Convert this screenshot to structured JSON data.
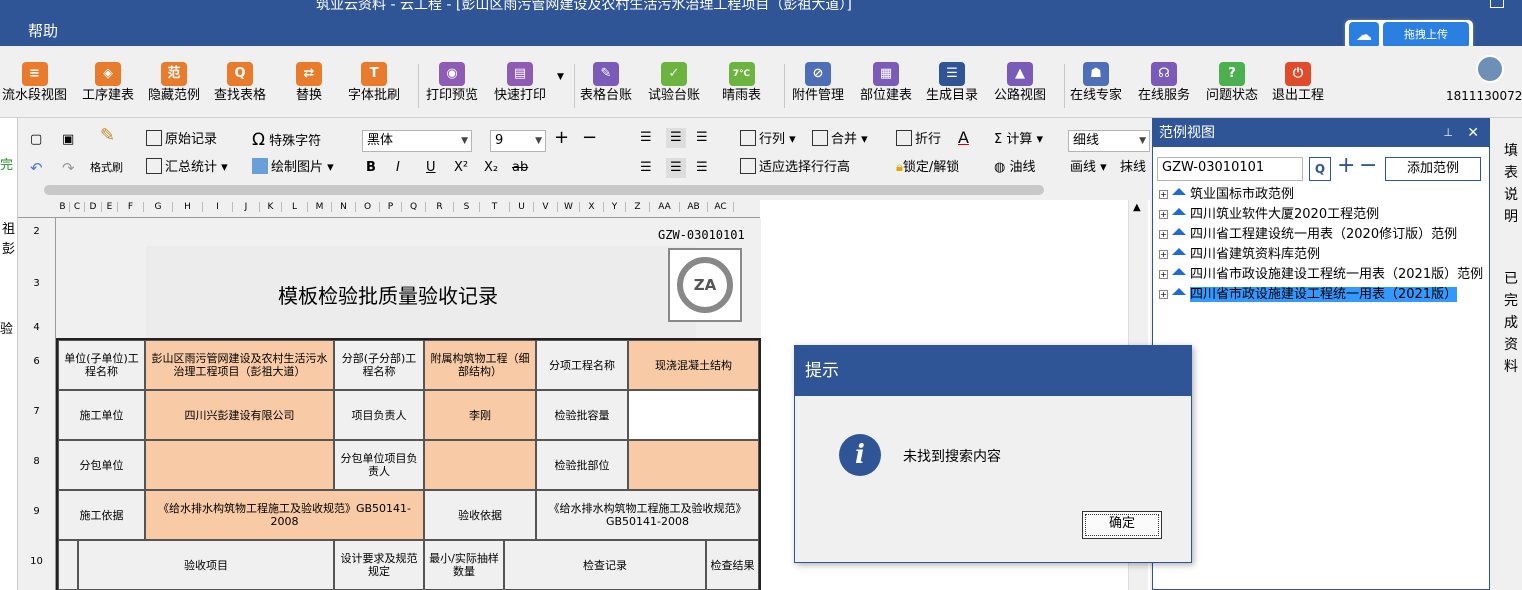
{
  "window": {
    "title": "筑业云资料 - 云工程 - [彭山区雨污管网建设及农村生活污水治理工程项目（彭祖大道）]"
  },
  "menu": {
    "help": "帮助"
  },
  "upload": {
    "label": "拖拽上传"
  },
  "user": {
    "phone": "1811130072"
  },
  "ribbon": {
    "items": [
      {
        "label": "流水段视图",
        "icon": "flow-icon",
        "color": "#e87b2c",
        "glyph": "≡"
      },
      {
        "label": "工序建表",
        "icon": "layers-icon",
        "color": "#e87b2c",
        "glyph": "◈"
      },
      {
        "label": "隐藏范例",
        "icon": "example-icon",
        "color": "#e87b2c",
        "glyph": "范"
      },
      {
        "label": "查找表格",
        "icon": "search-icon",
        "color": "#e87b2c",
        "glyph": "Q"
      },
      {
        "label": "替换",
        "icon": "replace-icon",
        "color": "#e87b2c",
        "glyph": "⇄"
      },
      {
        "label": "字体批刷",
        "icon": "font-brush-icon",
        "color": "#e87b2c",
        "glyph": "T"
      },
      {
        "label": "打印预览",
        "icon": "eye-icon",
        "color": "#8e5bb5",
        "glyph": "◉"
      },
      {
        "label": "快速打印",
        "icon": "printer-icon",
        "color": "#8e5bb5",
        "glyph": "▤"
      },
      {
        "label": "表格台账",
        "icon": "ledger-icon",
        "color": "#7a5cb8",
        "glyph": "✎"
      },
      {
        "label": "试验台账",
        "icon": "test-icon",
        "color": "#6cb33f",
        "glyph": "✓"
      },
      {
        "label": "晴雨表",
        "icon": "weather-icon",
        "color": "#6cb33f",
        "glyph": "7℃"
      },
      {
        "label": "附件管理",
        "icon": "attachment-icon",
        "color": "#4e6fb8",
        "glyph": "⊘"
      },
      {
        "label": "部位建表",
        "icon": "grid-icon",
        "color": "#7a5cb8",
        "glyph": "▦"
      },
      {
        "label": "生成目录",
        "icon": "catalog-icon",
        "color": "#2f5597",
        "glyph": "☰"
      },
      {
        "label": "公路视图",
        "icon": "road-icon",
        "color": "#7a5cb8",
        "glyph": "▲"
      },
      {
        "label": "在线专家",
        "icon": "expert-icon",
        "color": "#4e6fb8",
        "glyph": "☗"
      },
      {
        "label": "在线服务",
        "icon": "service-icon",
        "color": "#7a5cb8",
        "glyph": "☊"
      },
      {
        "label": "问题状态",
        "icon": "question-icon",
        "color": "#4caf50",
        "glyph": "?"
      },
      {
        "label": "退出工程",
        "icon": "power-icon",
        "color": "#e04b2c",
        "glyph": "⏻"
      }
    ]
  },
  "format": {
    "format_brush": "格式刷",
    "original_record": "原始记录",
    "special_char": "特殊字符",
    "summary_stats": "汇总统计",
    "draw_image": "绘制图片",
    "font_name": "黑体",
    "font_size": "9",
    "row_col": "行列",
    "merge": "合并",
    "fold_line": "折行",
    "calculate": "计算",
    "line_style": "细线",
    "fit_rows": "适应选择行行高",
    "lock_unlock": "锁定/解锁",
    "oil_line": "油线",
    "draw_line": "画线",
    "erase_line": "抹线"
  },
  "sheet": {
    "columns": [
      "B",
      "C",
      "D",
      "E",
      "F",
      "G",
      "H",
      "I",
      "J",
      "K",
      "L",
      "M",
      "N",
      "O",
      "P",
      "Q",
      "R",
      "S",
      "T",
      "U",
      "V",
      "W",
      "X",
      "Y",
      "Z",
      "AA",
      "AB",
      "AC"
    ],
    "rows": [
      "2",
      "3",
      "4",
      "6",
      "7",
      "8",
      "9",
      "10"
    ],
    "code": "GZW-03010101",
    "logo_text": "ZA",
    "form_title": "模板检验批质量验收记录",
    "cells": {
      "unit_label": "单位(子单位)工程名称",
      "unit_value": "彭山区雨污管网建设及农村生活污水治理工程项目（彭祖大道）",
      "division_label": "分部(子分部)工程名称",
      "division_value": "附属构筑物工程（细部结构）",
      "subitem_label": "分项工程名称",
      "subitem_value": "现浇混凝土结构",
      "constructor_label": "施工单位",
      "constructor_value": "四川兴彭建设有限公司",
      "pm_label": "项目负责人",
      "pm_value": "李刚",
      "capacity_label": "检验批容量",
      "capacity_value": "",
      "sub_label": "分包单位",
      "sub_value": "",
      "sub_pm_label": "分包单位项目负责人",
      "sub_pm_value": "",
      "location_label": "检验批部位",
      "location_value": "",
      "basis_label": "施工依据",
      "basis_value": "《给水排水构筑物工程施工及验收规范》GB50141-2008",
      "accept_label": "验收依据",
      "accept_value": "《给水排水构筑物工程施工及验收规范》GB50141-2008",
      "items_label": "验收项目",
      "design_label": "设计要求及规范规定",
      "sample_label": "最小/实际抽样数量",
      "record_label": "检查记录",
      "result_label": "检查结果"
    }
  },
  "panel": {
    "title": "范例视图",
    "search_value": "GZW-03010101",
    "add_label": "添加范例",
    "tree": [
      "筑业国标市政范例",
      "四川筑业软件大厦2020工程范例",
      "四川省工程建设统一用表（2020修订版）范例",
      "四川省建筑资料库范例",
      "四川省市政设施建设工程统一用表（2021版）范例",
      "四川省市政设施建设工程统一用表（2021版）"
    ]
  },
  "dialog": {
    "title": "提示",
    "message": "未找到搜索内容",
    "ok": "确定"
  },
  "left_fragments": [
    "完",
    "祖",
    "彭",
    "验"
  ],
  "right_fragments": [
    "填",
    "表",
    "说",
    "明",
    "已",
    "完",
    "成",
    "资",
    "料"
  ]
}
